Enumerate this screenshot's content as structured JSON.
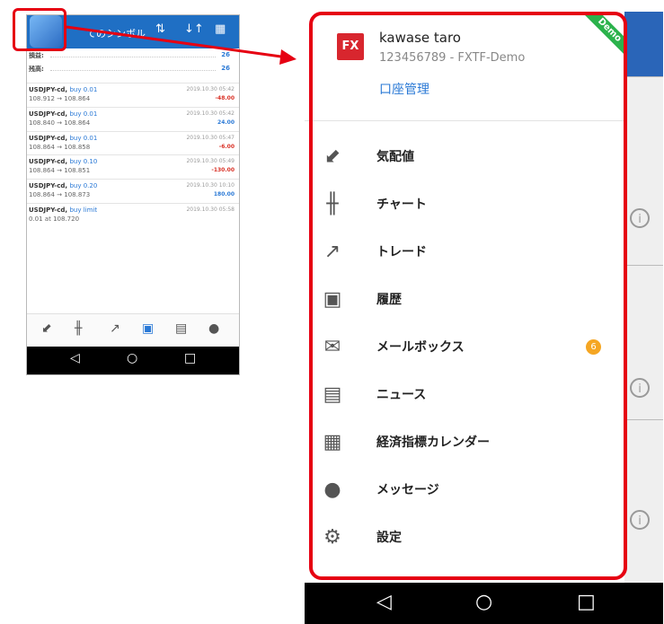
{
  "small_phone": {
    "title": "てのシンボル",
    "balance_rows": [
      {
        "label": "損益:",
        "value": "26"
      },
      {
        "label": "残高:",
        "value": "26"
      }
    ],
    "orders": [
      {
        "symbol": "USDJPY-cd,",
        "direction": "buy 0.01",
        "price": "108.912 → 108.864",
        "date": "2019.10.30 05:42",
        "profit": "-48.00",
        "sign": "neg"
      },
      {
        "symbol": "USDJPY-cd,",
        "direction": "buy 0.01",
        "price": "108.840 → 108.864",
        "date": "2019.10.30 05:42",
        "profit": "24.00",
        "sign": "pos"
      },
      {
        "symbol": "USDJPY-cd,",
        "direction": "buy 0.01",
        "price": "108.864 → 108.858",
        "date": "2019.10.30 05:47",
        "profit": "-6.00",
        "sign": "neg"
      },
      {
        "symbol": "USDJPY-cd,",
        "direction": "buy 0.10",
        "price": "108.864 → 108.851",
        "date": "2019.10.30 05:49",
        "profit": "-130.00",
        "sign": "neg"
      },
      {
        "symbol": "USDJPY-cd,",
        "direction": "buy 0.20",
        "price": "108.864 → 108.873",
        "date": "2019.10.30 10:10",
        "profit": "180.00",
        "sign": "pos"
      },
      {
        "symbol": "USDJPY-cd,",
        "direction": "buy limit",
        "price": "0.01 at 108.720",
        "date": "2019.10.30 05:58",
        "profit": "",
        "sign": "pos"
      }
    ]
  },
  "drawer": {
    "account_name": "kawase taro",
    "account_id": "123456789 - FXTF-Demo",
    "account_manage": "口座管理",
    "logo_text": "FX",
    "ribbon": "Demo",
    "menu": [
      {
        "label": "気配値",
        "icon": "quotes-icon"
      },
      {
        "label": "チャート",
        "icon": "chart-icon"
      },
      {
        "label": "トレード",
        "icon": "trade-icon"
      },
      {
        "label": "履歴",
        "icon": "history-icon"
      },
      {
        "label": "メールボックス",
        "icon": "mail-icon",
        "badge": "6"
      },
      {
        "label": "ニュース",
        "icon": "news-icon"
      },
      {
        "label": "経済指標カレンダー",
        "icon": "calendar-icon"
      },
      {
        "label": "メッセージ",
        "icon": "message-icon"
      },
      {
        "label": "設定",
        "icon": "settings-icon"
      }
    ]
  },
  "colors": {
    "highlight": "#e60012",
    "accent": "#2a79d6",
    "appbar": "#1f6fc4",
    "badge": "#f5a623"
  }
}
